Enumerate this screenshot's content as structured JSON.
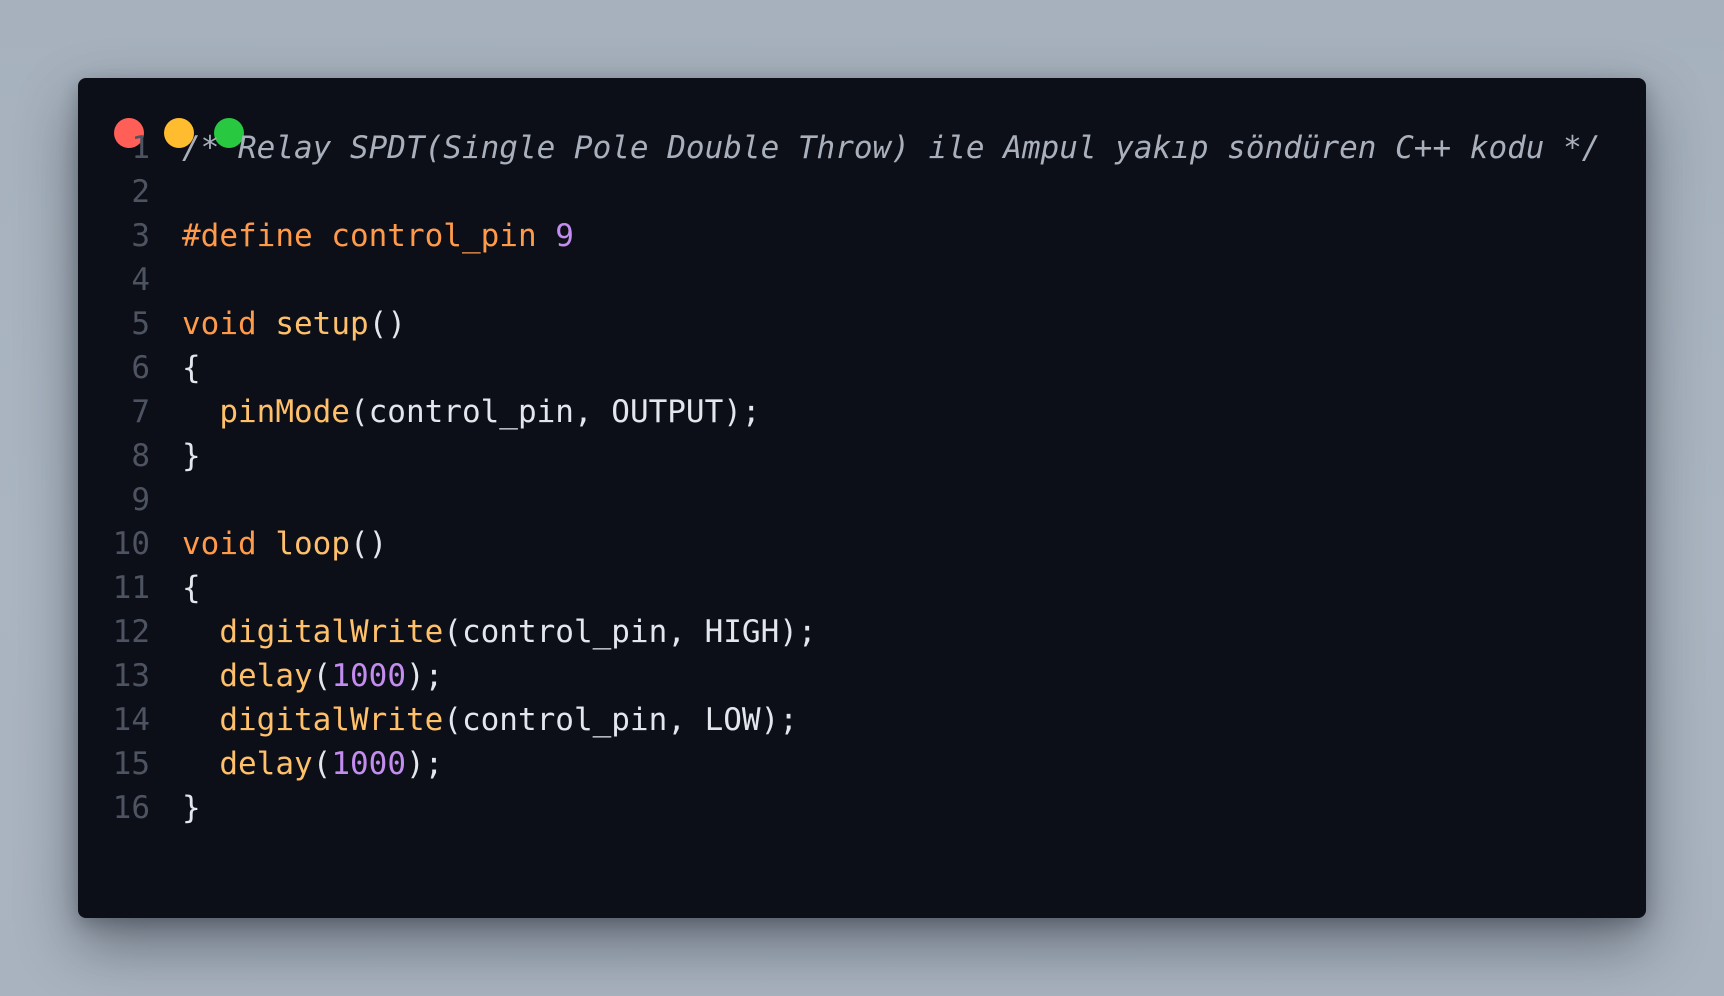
{
  "window": {
    "controls": {
      "close_color": "#ff5f57",
      "minimize_color": "#febc2e",
      "maximize_color": "#28c840"
    }
  },
  "code": {
    "language": "C++",
    "lines": [
      {
        "number": "1",
        "tokens": [
          {
            "type": "comment",
            "text": "/* Relay SPDT(Single Pole Double Throw) ile Ampul yakıp söndüren C++ kodu */"
          }
        ]
      },
      {
        "number": "2",
        "tokens": []
      },
      {
        "number": "3",
        "tokens": [
          {
            "type": "kw",
            "text": "#define control_pin"
          },
          {
            "type": "plain",
            "text": " "
          },
          {
            "type": "num",
            "text": "9"
          }
        ]
      },
      {
        "number": "4",
        "tokens": []
      },
      {
        "number": "5",
        "tokens": [
          {
            "type": "kw",
            "text": "void"
          },
          {
            "type": "plain",
            "text": " "
          },
          {
            "type": "fn",
            "text": "setup"
          },
          {
            "type": "plain",
            "text": "()"
          }
        ]
      },
      {
        "number": "6",
        "tokens": [
          {
            "type": "plain",
            "text": "{"
          }
        ]
      },
      {
        "number": "7",
        "tokens": [
          {
            "type": "plain",
            "text": "  "
          },
          {
            "type": "fn",
            "text": "pinMode"
          },
          {
            "type": "plain",
            "text": "(control_pin, OUTPUT);"
          }
        ]
      },
      {
        "number": "8",
        "tokens": [
          {
            "type": "plain",
            "text": "}"
          }
        ]
      },
      {
        "number": "9",
        "tokens": []
      },
      {
        "number": "10",
        "tokens": [
          {
            "type": "kw",
            "text": "void"
          },
          {
            "type": "plain",
            "text": " "
          },
          {
            "type": "fn",
            "text": "loop"
          },
          {
            "type": "plain",
            "text": "()"
          }
        ]
      },
      {
        "number": "11",
        "tokens": [
          {
            "type": "plain",
            "text": "{"
          }
        ]
      },
      {
        "number": "12",
        "tokens": [
          {
            "type": "plain",
            "text": "  "
          },
          {
            "type": "fn",
            "text": "digitalWrite"
          },
          {
            "type": "plain",
            "text": "(control_pin, HIGH);"
          }
        ]
      },
      {
        "number": "13",
        "tokens": [
          {
            "type": "plain",
            "text": "  "
          },
          {
            "type": "fn",
            "text": "delay"
          },
          {
            "type": "plain",
            "text": "("
          },
          {
            "type": "num",
            "text": "1000"
          },
          {
            "type": "plain",
            "text": ");"
          }
        ]
      },
      {
        "number": "14",
        "tokens": [
          {
            "type": "plain",
            "text": "  "
          },
          {
            "type": "fn",
            "text": "digitalWrite"
          },
          {
            "type": "plain",
            "text": "(control_pin, LOW);"
          }
        ]
      },
      {
        "number": "15",
        "tokens": [
          {
            "type": "plain",
            "text": "  "
          },
          {
            "type": "fn",
            "text": "delay"
          },
          {
            "type": "plain",
            "text": "("
          },
          {
            "type": "num",
            "text": "1000"
          },
          {
            "type": "plain",
            "text": ");"
          }
        ]
      },
      {
        "number": "16",
        "tokens": [
          {
            "type": "plain",
            "text": "}"
          }
        ]
      }
    ]
  }
}
